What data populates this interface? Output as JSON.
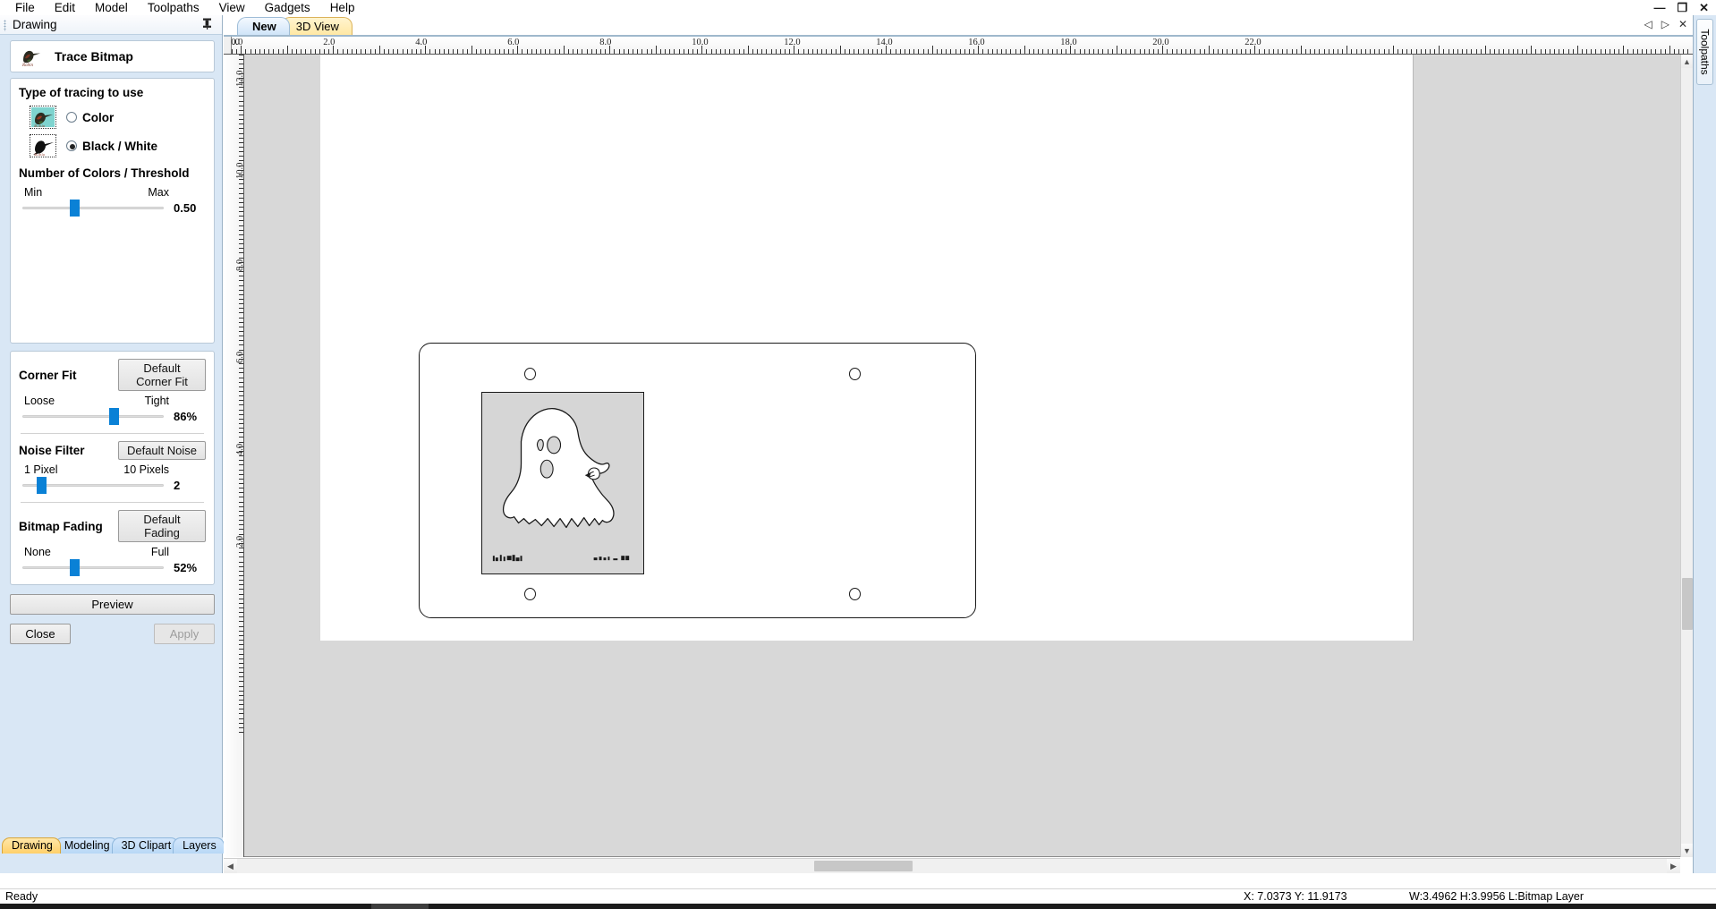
{
  "menu": {
    "items": [
      "File",
      "Edit",
      "Model",
      "Toolpaths",
      "View",
      "Gadgets",
      "Help"
    ]
  },
  "window_controls": {
    "minimize": "—",
    "restore": "❐",
    "close": "✕"
  },
  "left_dock": {
    "title": "Drawing",
    "pin_icon": "pin-icon",
    "tool": {
      "title": "Trace Bitmap",
      "icon": "bird-bitmap-icon"
    },
    "tracing": {
      "section_title": "Type of tracing to use",
      "options": [
        {
          "label": "Color",
          "selected": false,
          "thumb": "color-bird-thumbnail"
        },
        {
          "label": "Black / White",
          "selected": true,
          "thumb": "bw-bird-thumbnail"
        }
      ]
    },
    "threshold": {
      "section_title": "Number of Colors / Threshold",
      "min_label": "Min",
      "max_label": "Max",
      "value": "0.50",
      "knob_percent": 36
    },
    "corner_fit": {
      "section_title": "Corner Fit",
      "button": "Default Corner Fit",
      "min_label": "Loose",
      "max_label": "Tight",
      "value": "86%",
      "knob_percent": 66
    },
    "noise_filter": {
      "section_title": "Noise Filter",
      "button": "Default Noise",
      "min_label": "1 Pixel",
      "max_label": "10 Pixels",
      "value": "2",
      "knob_percent": 11
    },
    "bitmap_fading": {
      "section_title": "Bitmap Fading",
      "button": "Default Fading",
      "min_label": "None",
      "max_label": "Full",
      "value": "52%",
      "knob_percent": 36
    },
    "actions": {
      "preview": "Preview",
      "close": "Close",
      "apply": "Apply",
      "apply_disabled": true
    },
    "bottom_tabs": [
      {
        "label": "Drawing",
        "active": true
      },
      {
        "label": "Modeling",
        "active": false
      },
      {
        "label": "3D Clipart",
        "active": false
      },
      {
        "label": "Layers",
        "active": false
      }
    ]
  },
  "main": {
    "tabs": [
      {
        "label": "New",
        "selected": true
      },
      {
        "label": "3D View",
        "selected": false
      }
    ],
    "tab_nav": {
      "prev_icon": "triangle-left-icon",
      "next_icon": "triangle-right-icon",
      "close_icon": "close-icon"
    },
    "ruler_horizontal": {
      "origin_label": ".0",
      "labels": [
        "0.0",
        "2.0",
        "4.0",
        "6.0",
        "8.0",
        "10.0",
        "12.0",
        "14.0",
        "16.0",
        "18.0",
        "20.0",
        "22.0"
      ]
    },
    "ruler_vertical": {
      "labels": [
        "12.0",
        "10.0",
        "8.0",
        "6.0",
        "4.0",
        "2.0"
      ]
    },
    "artwork": {
      "description": "ghost-outline-bitmap",
      "bitmap_caption_left": "by J. Smith",
      "bitmap_caption_right": "ghost - bmp"
    }
  },
  "right_dock": {
    "tab_label": "Toolpaths"
  },
  "status_bar": {
    "message": "Ready",
    "coordinates": "X:  7.0373 Y: 11.9173",
    "dimensions": "W:3.4962   H:3.9956  L:Bitmap Layer"
  },
  "colors": {
    "accent_blue": "#0a81d6",
    "dock_bg": "#d9e7f5",
    "canvas_bg": "#d8d8d8",
    "bitmap_bg": "#d6d6d6",
    "active_tab_gold": "#ffd06a"
  }
}
